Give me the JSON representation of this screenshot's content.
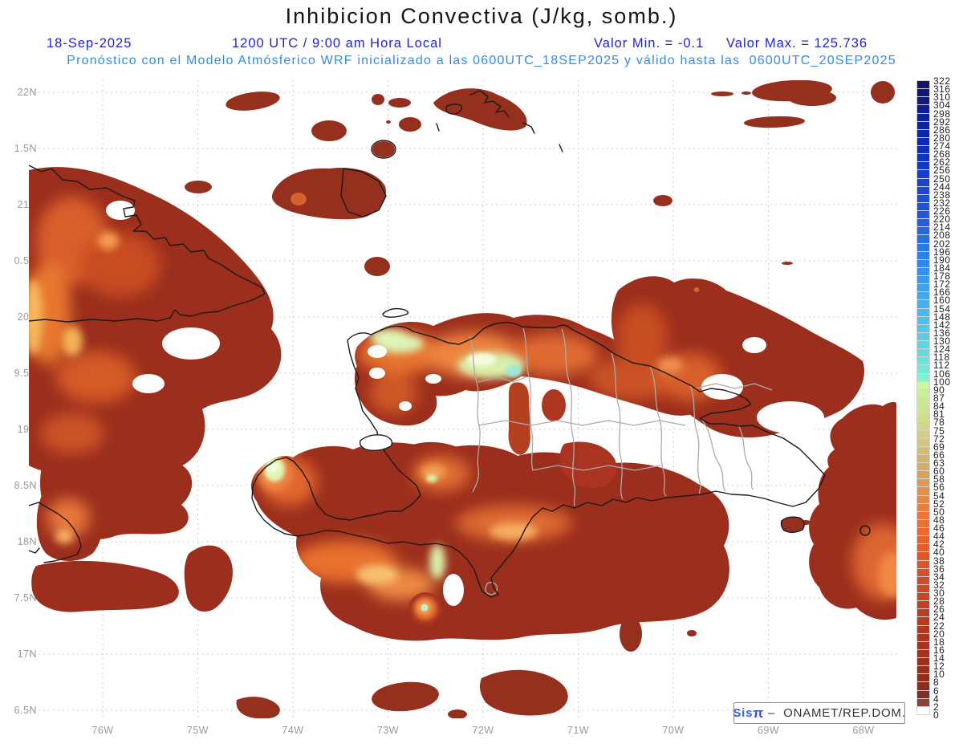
{
  "header": {
    "title": "Inhibicion Convectiva (J/kg, somb.)",
    "date": "18-Sep-2025",
    "time": "1200 UTC / 9:00 am Hora Local",
    "valor_min": "Valor Min. = -0.1",
    "valor_max": "Valor Max. = 125.736",
    "forecast_line": "Pronóstico con el Modelo Atmósferico WRF inicializado a las 0600UTC_18SEP2025 y válido hasta las  0600UTC_20SEP2025"
  },
  "map": {
    "units": "J/kg",
    "field_min": "-0.1",
    "field_max": "125.736"
  },
  "axes": {
    "lat_labels": [
      "22N",
      "1.5N",
      "21N",
      "0.5N",
      "20N",
      "9.5N",
      "19N",
      "8.5N",
      "18N",
      "7.5N",
      "17N",
      "6.5N"
    ],
    "lon_labels": [
      "76W",
      "75W",
      "74W",
      "73W",
      "72W",
      "71W",
      "70W",
      "69W",
      "68W"
    ]
  },
  "colorbar": {
    "tick_values": [
      322,
      316,
      310,
      304,
      298,
      292,
      286,
      280,
      274,
      268,
      262,
      256,
      250,
      244,
      238,
      232,
      226,
      220,
      214,
      208,
      202,
      196,
      190,
      184,
      178,
      172,
      166,
      160,
      154,
      148,
      142,
      136,
      130,
      124,
      118,
      112,
      106,
      100,
      90,
      87,
      84,
      81,
      78,
      75,
      72,
      69,
      66,
      63,
      60,
      58,
      56,
      54,
      52,
      50,
      48,
      46,
      44,
      42,
      40,
      38,
      36,
      34,
      32,
      30,
      28,
      26,
      24,
      22,
      20,
      18,
      16,
      14,
      12,
      10,
      8,
      6,
      4,
      2,
      0
    ],
    "color_stops": [
      [
        322,
        "#14146E"
      ],
      [
        300,
        "#0C1C96"
      ],
      [
        280,
        "#0A28B4"
      ],
      [
        250,
        "#1440D2"
      ],
      [
        220,
        "#1E5AE6"
      ],
      [
        190,
        "#2C86EE"
      ],
      [
        160,
        "#46ACF0"
      ],
      [
        142,
        "#4FC4EA"
      ],
      [
        130,
        "#55D3E4"
      ],
      [
        118,
        "#63E1DA"
      ],
      [
        106,
        "#75EED1"
      ],
      [
        100,
        "#8EF5C9"
      ],
      [
        97,
        "#CDF8A6"
      ],
      [
        90,
        "#C5F09C"
      ],
      [
        84,
        "#CCE794"
      ],
      [
        78,
        "#D3DA8C"
      ],
      [
        72,
        "#D3CA7F"
      ],
      [
        66,
        "#D2B972"
      ],
      [
        60,
        "#D4A860"
      ],
      [
        56,
        "#DD9552"
      ],
      [
        52,
        "#E78344"
      ],
      [
        50,
        "#EC793A"
      ],
      [
        46,
        "#EE6C32"
      ],
      [
        42,
        "#EA5E2C"
      ],
      [
        38,
        "#E15228"
      ],
      [
        32,
        "#D34924"
      ],
      [
        26,
        "#C13E20"
      ],
      [
        20,
        "#B1361D"
      ],
      [
        14,
        "#A1301B"
      ],
      [
        8,
        "#902B1A"
      ],
      [
        4,
        "#7F2E26"
      ],
      [
        2,
        "#97514D"
      ],
      [
        0,
        "#FFFFFF"
      ]
    ]
  },
  "logo": {
    "sis": "Sis",
    "pi": "π",
    "sep": " –  ",
    "org": "ONAMET/REP.DOM."
  }
}
